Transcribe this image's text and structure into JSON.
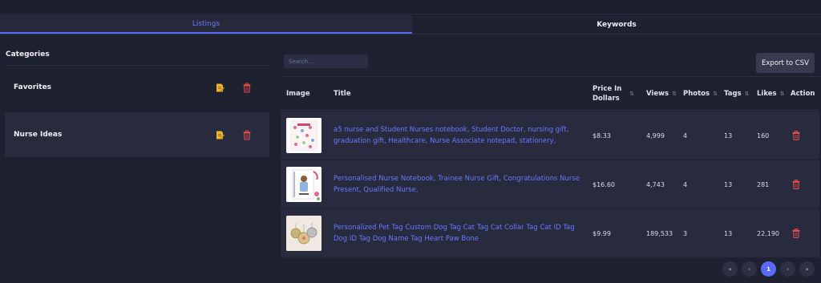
{
  "tabs": [
    {
      "label": "Listings",
      "active": true
    },
    {
      "label": "Keywords",
      "active": false
    }
  ],
  "categories": {
    "title": "Categories",
    "items": [
      {
        "label": "Favorites",
        "active": false
      },
      {
        "label": "Nurse Ideas",
        "active": true
      }
    ]
  },
  "toolbar": {
    "search_placeholder": "Search...",
    "export_label": "Export to CSV"
  },
  "table": {
    "headers": {
      "image": "Image",
      "title": "Title",
      "price": "Price In Dollars",
      "views": "Views",
      "photos": "Photos",
      "tags": "Tags",
      "likes": "Likes",
      "action": "Action"
    },
    "sort_glyph": "⇅",
    "rows": [
      {
        "title": "a5 nurse and Student Nurses notebook, Student Doctor, nursing gift, graduation gift, Healthcare, Nurse Associate notepad, stationery,",
        "price": "$8.33",
        "views": "4,999",
        "photos": "4",
        "tags": "13",
        "likes": "160"
      },
      {
        "title": "Personalised Nurse Notebook, Trainee Nurse Gift, Congratulations Nurse Present, Qualified Nurse,",
        "price": "$16.60",
        "views": "4,743",
        "photos": "4",
        "tags": "13",
        "likes": "281"
      },
      {
        "title": "Personalized Pet Tag Custom Dog Tag Cat Tag Cat Collar Tag Cat ID Tag Dog ID Tag Dog Name Tag Heart Paw Bone",
        "price": "$9.99",
        "views": "189,533",
        "photos": "3",
        "tags": "13",
        "likes": "22,190"
      }
    ]
  },
  "pagination": {
    "first": "«",
    "prev": "‹",
    "current": "1",
    "next": "›",
    "last": "»"
  },
  "colors": {
    "accent": "#5b6af5",
    "link": "#6a78ff",
    "delete": "#e84c4c",
    "edit": "#f0b429",
    "background": "#1e2130",
    "panel": "#272b3d"
  },
  "icons": {
    "edit": "edit-icon",
    "delete": "trash-icon"
  }
}
